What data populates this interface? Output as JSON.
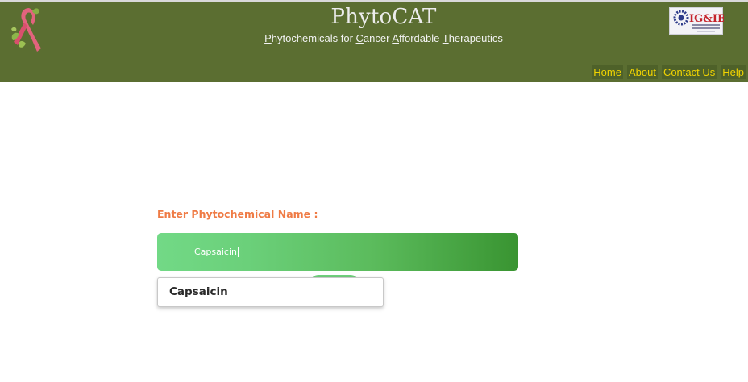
{
  "header": {
    "title": "PhytoCAT",
    "subtitle": {
      "p_cap": "P",
      "p_rest": "hytochemicals for ",
      "c_cap": "C",
      "c_rest": "ancer ",
      "a_cap": "A",
      "a_rest": "ffordable ",
      "t_cap": "T",
      "t_rest": "herapeutics"
    },
    "background_color": "#5b6e31",
    "logo_left_icon": "cancer-ribbon-leaf-icon",
    "logo_right_icon": "igib-institute-logo",
    "logo_right_text": "IG&IB"
  },
  "nav": {
    "items": [
      {
        "label": "Home"
      },
      {
        "label": "About"
      },
      {
        "label": "Contact Us"
      },
      {
        "label": "Help"
      }
    ],
    "text_color": "#f2d400"
  },
  "search": {
    "label": "Enter Phytochemical Name :",
    "value": "Capsaicin",
    "label_color": "#ef7b45"
  },
  "autocomplete": {
    "items": [
      {
        "label": "Capsaicin"
      }
    ]
  }
}
